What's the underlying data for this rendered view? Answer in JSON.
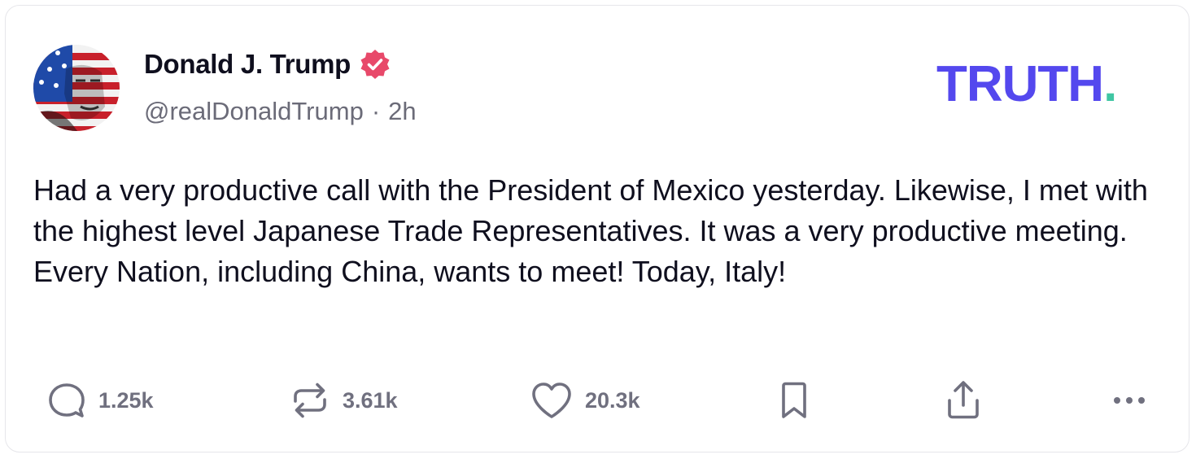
{
  "post": {
    "author": {
      "display_name": "Donald J. Trump",
      "verified_icon": "verified-badge-icon",
      "handle": "@realDonaldTrump",
      "separator": "·",
      "time": "2h"
    },
    "brand": {
      "logo_text": "TRUTH",
      "logo_dot": ".",
      "color": "#5448ee",
      "dot_color": "#40c6a3"
    },
    "body": "Had a very productive call with the President of Mexico yesterday. Likewise, I met with the highest level Japanese Trade Representatives. It was a very productive meeting. Every Nation, including China, wants to meet! Today, Italy!",
    "actions": {
      "replies": {
        "icon": "comment-icon",
        "count": "1.25k"
      },
      "retruths": {
        "icon": "repost-icon",
        "count": "3.61k"
      },
      "likes": {
        "icon": "heart-icon",
        "count": "20.3k"
      },
      "bookmark": {
        "icon": "bookmark-icon"
      },
      "share": {
        "icon": "share-icon"
      },
      "more": {
        "icon": "more-icon"
      }
    },
    "colors": {
      "verified": "#e8496a",
      "muted": "#70707f",
      "text": "#0f0f1e"
    }
  }
}
